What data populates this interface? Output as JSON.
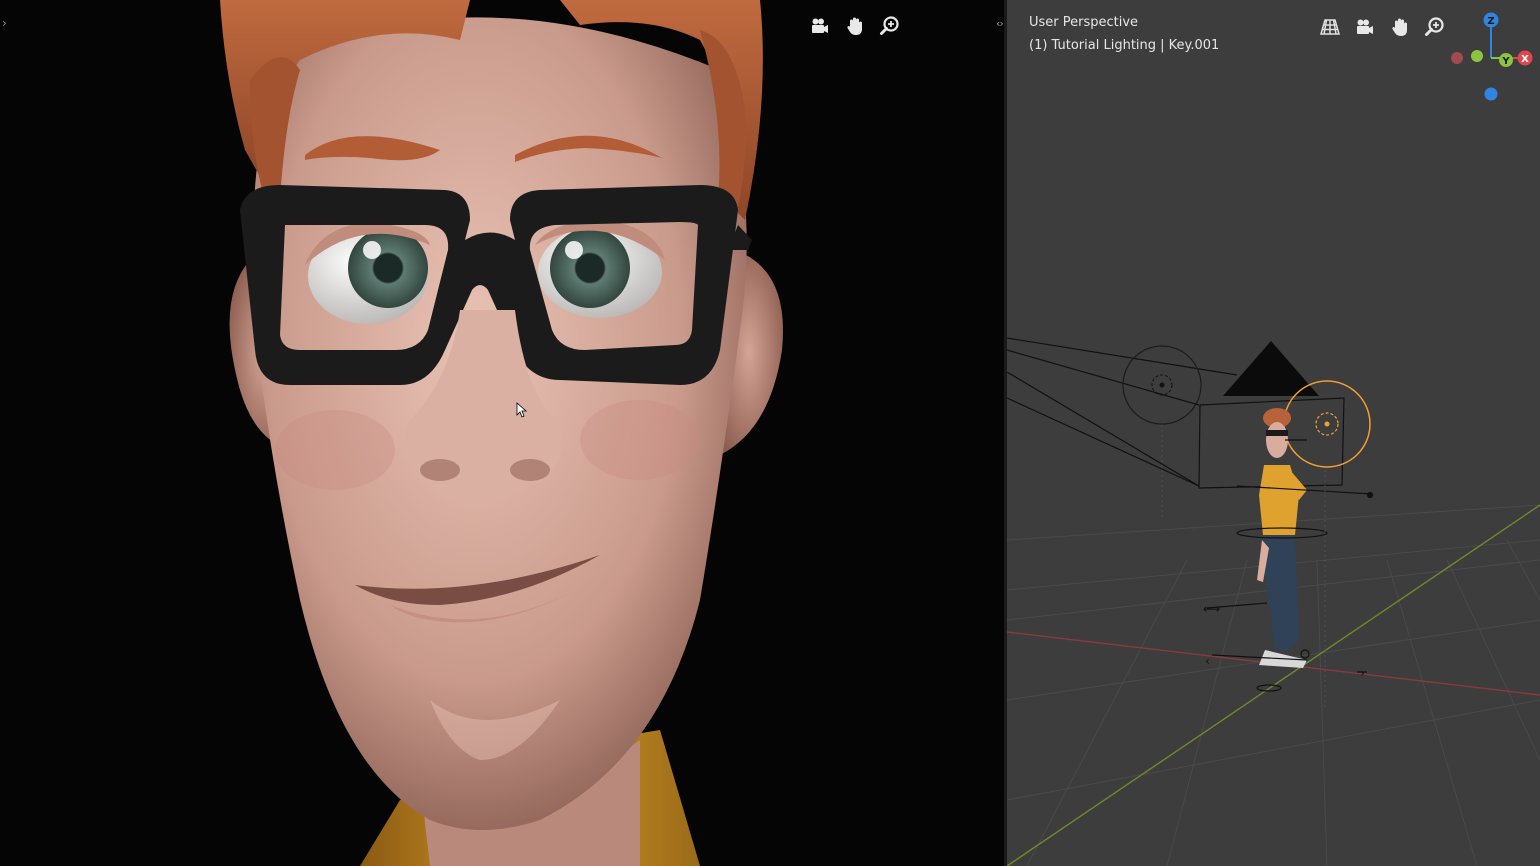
{
  "viewport_right": {
    "header": {
      "view_name": "User Perspective",
      "collection_info": "(1) Tutorial Lighting | Key.001"
    }
  },
  "nav_tools_left": [
    {
      "icon": "camera-view-icon"
    },
    {
      "icon": "hand-pan-icon"
    },
    {
      "icon": "zoom-icon"
    }
  ],
  "nav_tools_right": [
    {
      "icon": "perspective-grid-icon"
    },
    {
      "icon": "camera-view-icon"
    },
    {
      "icon": "hand-pan-icon"
    },
    {
      "icon": "zoom-icon"
    }
  ],
  "gizmo": {
    "z_label": "Z",
    "y_label": "Y",
    "x_label": "X",
    "colors": {
      "x": "#e0464f",
      "y": "#8bc43f",
      "z": "#2f85e0"
    }
  },
  "colors": {
    "left_viewport_bg": "#050505",
    "right_viewport_bg": "#3d3d3d",
    "skin": "#d7aea0",
    "hair": "#b8623a",
    "glasses": "#1a1a1a",
    "shirt": "#d89b2a",
    "selection_orange": "#f0a030"
  }
}
